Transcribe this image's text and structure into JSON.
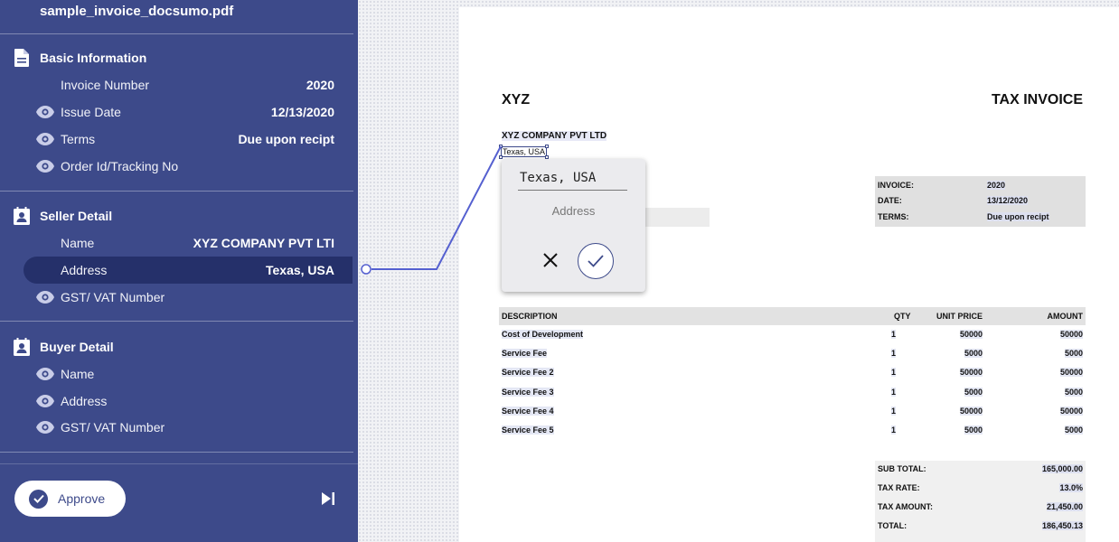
{
  "sidebar": {
    "file_name": "sample_invoice_docsumo.pdf",
    "sections": [
      {
        "title": "Basic Information",
        "icon": "document-icon",
        "fields": [
          {
            "label": "Invoice Number",
            "value": "2020",
            "visible_toggle": false
          },
          {
            "label": "Issue Date",
            "value": "12/13/2020",
            "visible_toggle": true
          },
          {
            "label": "Terms",
            "value": "Due upon recipt",
            "visible_toggle": true
          },
          {
            "label": "Order Id/Tracking No",
            "value": "",
            "visible_toggle": true
          }
        ]
      },
      {
        "title": "Seller Detail",
        "icon": "contact-card-icon",
        "fields": [
          {
            "label": "Name",
            "value": "XYZ COMPANY PVT LTI",
            "visible_toggle": false
          },
          {
            "label": "Address",
            "value": "Texas, USA",
            "visible_toggle": false,
            "selected": true
          },
          {
            "label": "GST/ VAT Number",
            "value": "",
            "visible_toggle": true
          }
        ]
      },
      {
        "title": "Buyer Detail",
        "icon": "contact-card-icon",
        "fields": [
          {
            "label": "Name",
            "value": "",
            "visible_toggle": true
          },
          {
            "label": "Address",
            "value": "",
            "visible_toggle": true
          },
          {
            "label": "GST/ VAT Number",
            "value": "",
            "visible_toggle": true
          }
        ]
      }
    ],
    "approve_label": "Approve"
  },
  "popup": {
    "input_value": "Texas, USA",
    "field_label": "Address"
  },
  "invoice": {
    "brand": "XYZ",
    "title": "TAX INVOICE",
    "company": "XYZ COMPANY PVT LTD",
    "address": "Texas, USA",
    "meta": [
      {
        "key": "INVOICE:",
        "value": "2020"
      },
      {
        "key": "DATE:",
        "value": "13/12/2020"
      },
      {
        "key": "TERMS:",
        "value": "Due upon recipt"
      }
    ],
    "table": {
      "headers": {
        "desc": "DESCRIPTION",
        "qty": "QTY",
        "price": "UNIT PRICE",
        "amount": "AMOUNT"
      },
      "rows": [
        {
          "desc": "Cost of Development",
          "qty": "1",
          "price": "50000",
          "amount": "50000"
        },
        {
          "desc": "Service Fee",
          "qty": "1",
          "price": "5000",
          "amount": "5000"
        },
        {
          "desc": "Service Fee 2",
          "qty": "1",
          "price": "50000",
          "amount": "50000"
        },
        {
          "desc": "Service Fee 3",
          "qty": "1",
          "price": "5000",
          "amount": "5000"
        },
        {
          "desc": "Service Fee 4",
          "qty": "1",
          "price": "50000",
          "amount": "50000"
        },
        {
          "desc": "Service Fee 5",
          "qty": "1",
          "price": "5000",
          "amount": "5000"
        }
      ]
    },
    "totals": [
      {
        "key": "SUB TOTAL:",
        "value": "165,000.00"
      },
      {
        "key": "TAX RATE:",
        "value": "13.0%"
      },
      {
        "key": "TAX AMOUNT:",
        "value": "21,450.00"
      },
      {
        "key": "TOTAL:",
        "value": "186,450.13"
      }
    ]
  },
  "colors": {
    "sidebar_bg": "#3d4a8a",
    "selected_bg": "#25306a",
    "connector": "#5560d0"
  }
}
